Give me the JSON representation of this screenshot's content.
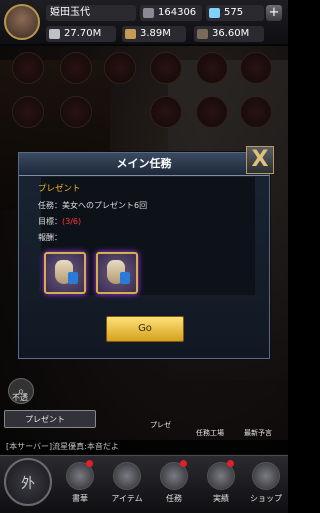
{
  "topbar": {
    "player_name": "姫田玉代",
    "stat1": "164306",
    "stat2": "575",
    "row2_a": "27.70M",
    "row2_b": "3.89M",
    "row2_c": "36.60M",
    "plus": "+"
  },
  "dialog": {
    "title": "メイン任務",
    "close": "X",
    "heading": "プレゼント",
    "task_label": "任務：美女へのプレゼント6回",
    "goal_label": "目標：",
    "goal_value": "(3/6)",
    "reward_label": "報酬：",
    "go_button": "Go"
  },
  "side": {
    "search_label": "不透",
    "present_btn": "プレゼント",
    "icon1": "プレゼ",
    "icon2": "任務工場",
    "icon3": "最新予言"
  },
  "chat": "[本サーバー]流星優真:本音だよ",
  "nav": {
    "round": "外",
    "items": [
      "書華",
      "アイテム",
      "任務",
      "実績",
      "ショップ"
    ]
  },
  "colors": {
    "accent_gold": "#f2b52a",
    "progress_red": "#ff3a3a",
    "button_gold": "#ffe07a"
  }
}
